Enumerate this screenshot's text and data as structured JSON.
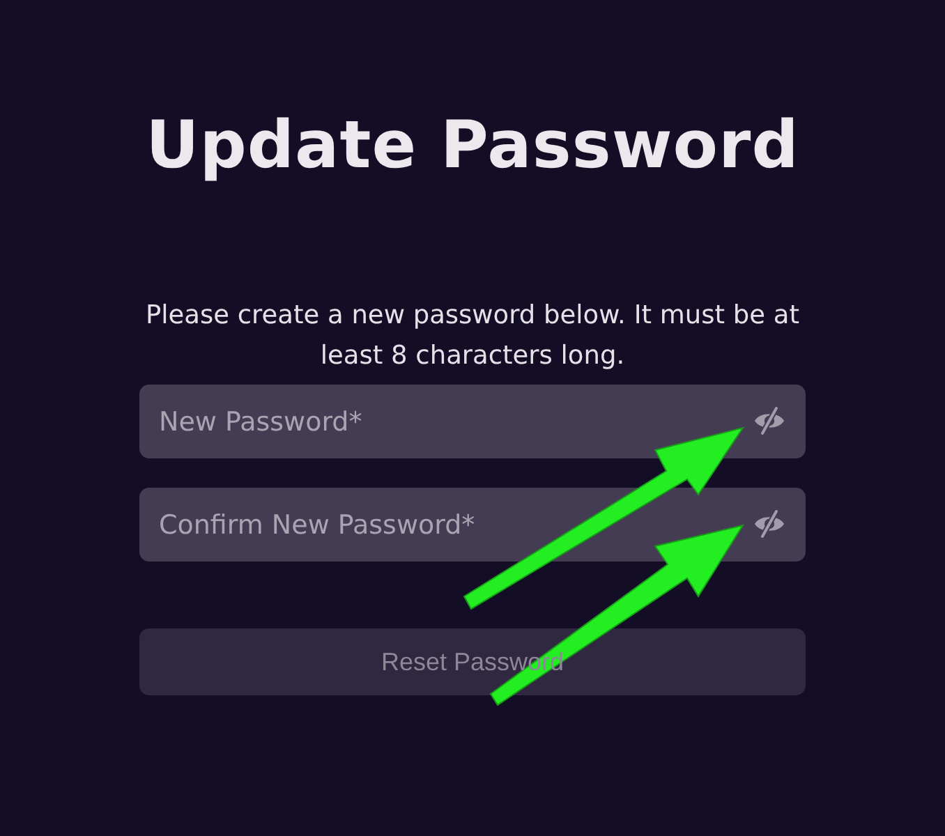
{
  "title": "Update Password",
  "instructions": "Please create a new password below. It must be at least 8 characters long.",
  "fields": [
    {
      "placeholder": "New Password*",
      "hidden": true
    },
    {
      "placeholder": "Confirm New Password*",
      "hidden": true
    }
  ],
  "submit_button": {
    "label": "Reset Password",
    "disabled": true
  }
}
